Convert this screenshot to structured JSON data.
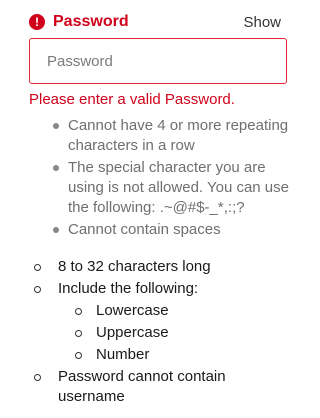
{
  "field": {
    "label": "Password",
    "show_label": "Show",
    "placeholder": "Password",
    "error_message": "Please enter a valid Password.",
    "error_icon": "!"
  },
  "error_rules": [
    "Cannot have 4 or more repeating characters in a row",
    "The special character you are using is not allowed. You can use the following: .~@#$-_*,:;?",
    "Cannot contain spaces"
  ],
  "requirements": {
    "length": "8 to 32 characters long",
    "include": "Include the following:",
    "include_items": [
      "Lowercase",
      "Uppercase",
      "Number"
    ],
    "username": "Password cannot contain username"
  },
  "colors": {
    "error": "#d0021b",
    "border_error": "#e0283a",
    "muted_text": "#6f6f6f"
  }
}
